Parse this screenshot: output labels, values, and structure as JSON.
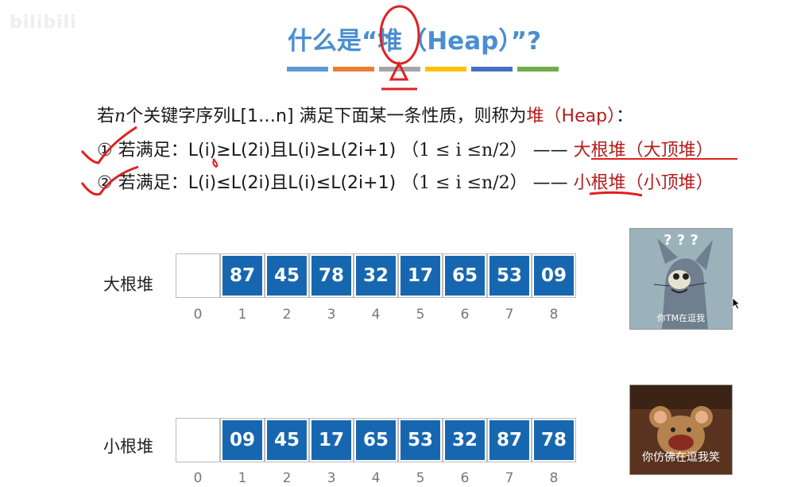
{
  "watermark": "bilibili",
  "title": {
    "pre": "什么是“",
    "key": "堆",
    "post": "（Heap）”?"
  },
  "colorbar": [
    "#5b9bd5",
    "#ed7d31",
    "#a5a5a5",
    "#ffc000",
    "#4472c4",
    "#70ad47"
  ],
  "definition": {
    "part1": "若",
    "n": "n",
    "part2": "个关键字序列L[1…n] 满足下面某一条性质，则称为",
    "heap": "堆（Heap）",
    "colon": "："
  },
  "rule1": {
    "num": "①",
    "text": " 若满足：L(i)≥L(2i)且L(i)≥L(2i+1) ",
    "range": "（1 ≤ i ≤n/2）",
    "dash": " —— ",
    "result": "大根堆（大顶堆）"
  },
  "rule2": {
    "num": "②",
    "text": " 若满足：L(i)≤L(2i)且L(i)≤L(2i+1) ",
    "range": "（1 ≤ i ≤n/2）",
    "dash": " —— ",
    "result": "小根堆（小顶堆）"
  },
  "max_heap": {
    "label": "大根堆",
    "values": [
      "",
      "87",
      "45",
      "78",
      "32",
      "17",
      "65",
      "53",
      "09"
    ],
    "indices": [
      "0",
      "1",
      "2",
      "3",
      "4",
      "5",
      "6",
      "7",
      "8"
    ]
  },
  "min_heap": {
    "label": "小根堆",
    "values": [
      "",
      "09",
      "45",
      "17",
      "65",
      "53",
      "32",
      "87",
      "78"
    ],
    "indices": [
      "0",
      "1",
      "2",
      "3",
      "4",
      "5",
      "6",
      "7",
      "8"
    ]
  },
  "meme1": {
    "marks": "? ? ?",
    "caption": "你TM在逗我"
  },
  "meme2": {
    "caption": "你仿佛在逗我笑"
  }
}
